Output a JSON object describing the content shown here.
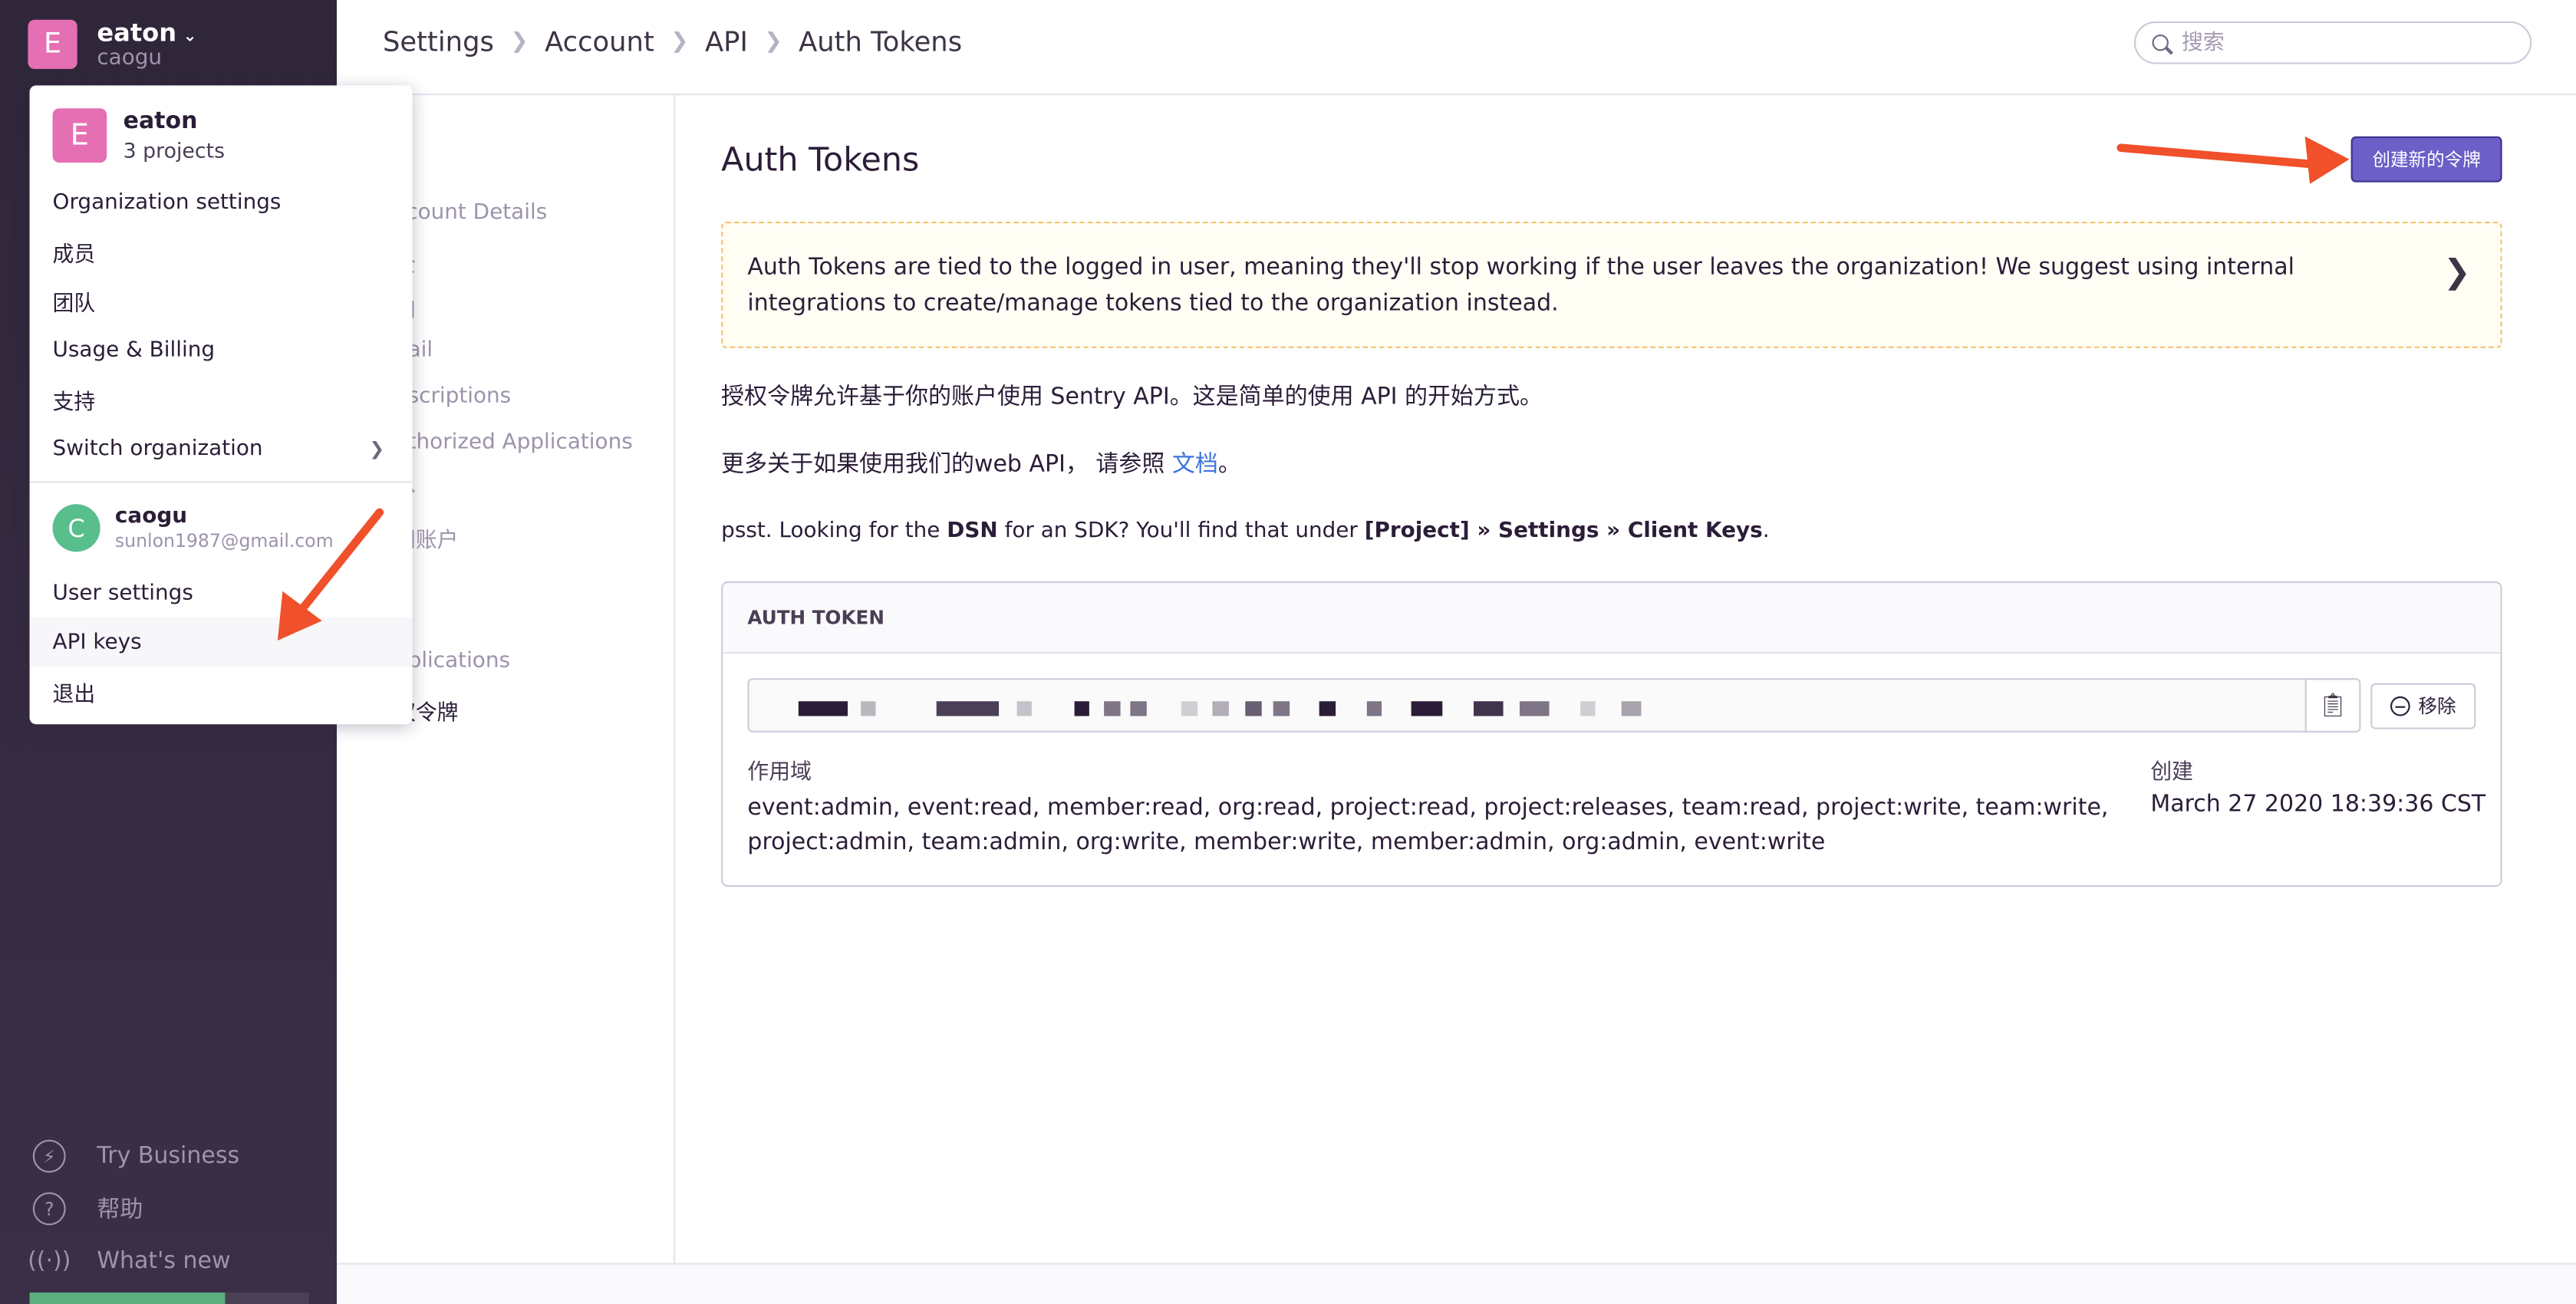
{
  "org": {
    "initial": "E",
    "name": "eaton",
    "username": "caogu"
  },
  "sidebar_bottom": [
    {
      "label": "Try Business",
      "icon": "lightning-icon"
    },
    {
      "label": "帮助",
      "icon": "help-icon"
    },
    {
      "label": "What's new",
      "icon": "broadcast-icon"
    }
  ],
  "sidebar_progress": 0.7,
  "breadcrumbs": [
    "Settings",
    "Account",
    "API",
    "Auth Tokens"
  ],
  "search": {
    "placeholder": "搜索"
  },
  "settings_nav": [
    {
      "label": "ccount Details"
    },
    {
      "label": "全"
    },
    {
      "label": "知"
    },
    {
      "label": "nail"
    },
    {
      "label": "bscriptions"
    },
    {
      "label": "uthorized Applications"
    },
    {
      "label": "份"
    },
    {
      "label": "闭账户"
    },
    {
      "label": "pplications"
    },
    {
      "label": "权令牌"
    }
  ],
  "main": {
    "title": "Auth Tokens",
    "create_button": "创建新的令牌",
    "alert": "Auth Tokens are tied to the logged in user, meaning they'll stop working if the user leaves the organization! We suggest using internal integrations to create/manage tokens tied to the organization instead.",
    "intro": "授权令牌允许基于你的账户使用 Sentry API。这是简单的使用 API 的开始方式。",
    "docs_prefix": "更多关于如果使用我们的web API， 请参照",
    "docs_link": "文档",
    "docs_suffix": "。",
    "dsn_hint": {
      "t1": "psst. Looking for the ",
      "dsn": "DSN",
      "t2": " for an SDK? You'll find that under ",
      "path": "[Project] » Settings » Client Keys",
      "t3": "."
    },
    "panel": {
      "header": "AUTH TOKEN",
      "remove_button": "移除",
      "scope_label": "作用域",
      "scopes": "event:admin, event:read, member:read, org:read, project:read, project:releases, team:read, project:write, team:write, project:admin, team:admin, org:write, member:write, member:admin, org:admin, event:write",
      "created_label": "创建",
      "created_value": "March 27 2020 18:39:36 CST"
    }
  },
  "dropdown": {
    "org_initial": "E",
    "org_name": "eaton",
    "org_projects": "3 projects",
    "org_items": [
      {
        "label": "Organization settings"
      },
      {
        "label": "成员"
      },
      {
        "label": "团队"
      },
      {
        "label": "Usage & Billing"
      },
      {
        "label": "支持"
      },
      {
        "label": "Switch organization"
      }
    ],
    "user_initial": "C",
    "user_name": "caogu",
    "user_email": "sunlon1987@gmail.com",
    "user_items": [
      {
        "label": "User settings"
      },
      {
        "label": "API keys"
      },
      {
        "label": "退出"
      }
    ]
  },
  "colors": {
    "sidebar_bg": "#2f2639",
    "accent": "#6c5fc7",
    "avatar_org": "#e56fb3",
    "avatar_user": "#57be8c",
    "annotation_arrow": "#f0502a",
    "link": "#3d74db",
    "alert_border": "#f5c26b"
  }
}
